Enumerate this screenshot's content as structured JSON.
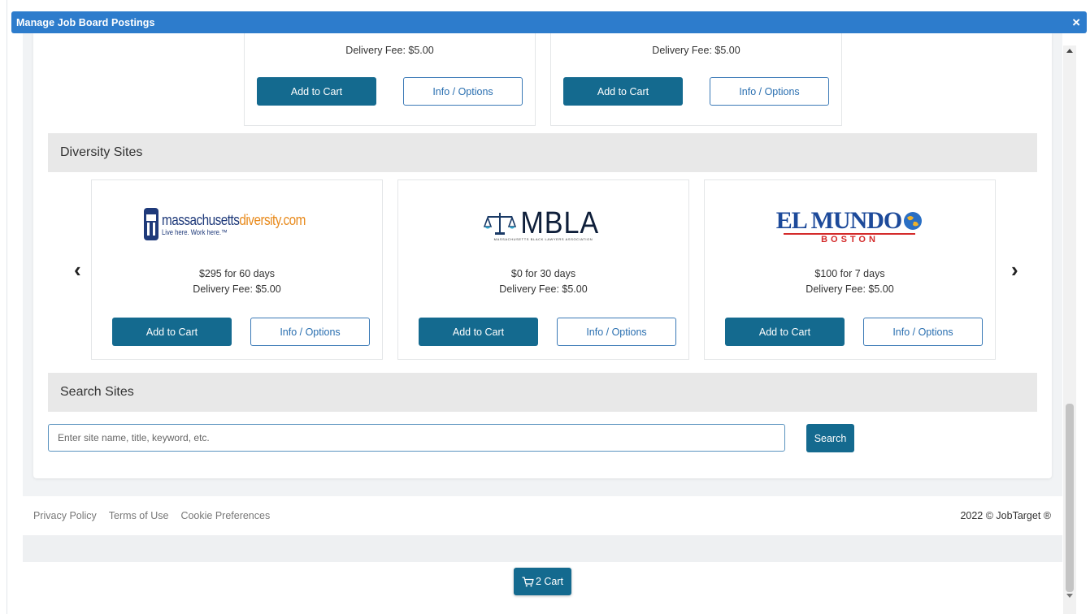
{
  "window": {
    "title": "Manage Job Board Postings",
    "close_glyph": "×"
  },
  "top_vendors": [
    {
      "fee": "Delivery Fee: $5.00",
      "add_label": "Add to Cart",
      "info_label": "Info / Options"
    },
    {
      "fee": "Delivery Fee: $5.00",
      "add_label": "Add to Cart",
      "info_label": "Info / Options"
    }
  ],
  "diversity": {
    "heading": "Diversity Sites",
    "prev_glyph": "‹",
    "next_glyph": "›",
    "vendors": [
      {
        "logo": {
          "main": "massachusetts",
          "accent": "diversity.com",
          "tagline": "Live here. Work here.™"
        },
        "price": "$295 for 60 days",
        "fee": "Delivery Fee: $5.00",
        "add_label": "Add to Cart",
        "info_label": "Info / Options"
      },
      {
        "logo": {
          "main": "MBLA",
          "tagline": "MASSACHUSETTS BLACK LAWYERS ASSOCIATION"
        },
        "price": "$0 for 30 days",
        "fee": "Delivery Fee: $5.00",
        "add_label": "Add to Cart",
        "info_label": "Info / Options"
      },
      {
        "logo": {
          "main": "EL MUNDO",
          "sub": "BOSTON"
        },
        "price": "$100 for 7 days",
        "fee": "Delivery Fee: $5.00",
        "add_label": "Add to Cart",
        "info_label": "Info / Options"
      }
    ]
  },
  "search": {
    "heading": "Search Sites",
    "placeholder": "Enter site name, title, keyword, etc.",
    "value": "",
    "button_label": "Search"
  },
  "footer": {
    "links": [
      "Privacy Policy",
      "Terms of Use",
      "Cookie Preferences"
    ],
    "copyright": "2022 © JobTarget ®"
  },
  "cart": {
    "label": "2 Cart",
    "icon": "cart-icon"
  },
  "colors": {
    "primary": "#146a8f",
    "titlebar": "#2d7ccc",
    "outline": "#3a79b6"
  }
}
